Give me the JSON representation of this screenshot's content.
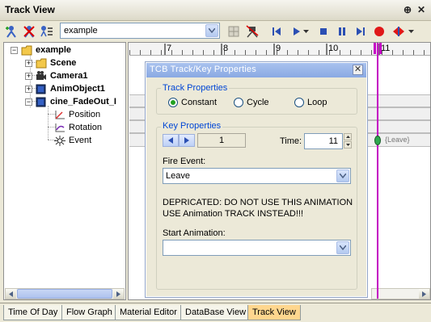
{
  "window": {
    "title": "Track View",
    "pin_glyph": "⊕",
    "close_glyph": "✕"
  },
  "toolbar": {
    "track_select_value": "example"
  },
  "tree": {
    "items": [
      {
        "label": "example",
        "expander": "−"
      },
      {
        "label": "Scene",
        "expander": "+"
      },
      {
        "label": "Camera1",
        "expander": "+"
      },
      {
        "label": "AnimObject1",
        "expander": "+"
      },
      {
        "label": "cine_FadeOut_I",
        "expander": "−"
      },
      {
        "label": "Position"
      },
      {
        "label": "Rotation"
      },
      {
        "label": "Event"
      }
    ]
  },
  "timeline": {
    "ticks": [
      "7",
      "8",
      "9",
      "10",
      "11"
    ],
    "key_label": "{Leave}"
  },
  "dialog": {
    "title": "TCB Track/Key Properties",
    "close_glyph": "✕",
    "track_properties_title": "Track Properties",
    "track_modes": [
      "Constant",
      "Cycle",
      "Loop"
    ],
    "selected_mode": "Constant",
    "key_properties_title": "Key Properties",
    "key_index": "1",
    "time_label": "Time:",
    "time_value": "11",
    "fire_event_label": "Fire Event:",
    "fire_event_value": "Leave",
    "warning_line1": "DEPRICATED: DO NOT USE THIS ANIMATION",
    "warning_line2": "USE Animation TRACK INSTEAD!!!",
    "start_animation_label": "Start Animation:",
    "start_animation_value": ""
  },
  "tabs": [
    {
      "label": "Time Of Day",
      "active": false
    },
    {
      "label": "Flow Graph",
      "active": false
    },
    {
      "label": "Material Editor",
      "active": false
    },
    {
      "label": "DataBase View",
      "active": false
    },
    {
      "label": "Track View",
      "active": true
    }
  ],
  "colors": {
    "accent_blue": "#0046d5",
    "playhead": "#c400c4",
    "active_tab": "#ffd68e",
    "dialog_title": "#8aa9e3"
  }
}
